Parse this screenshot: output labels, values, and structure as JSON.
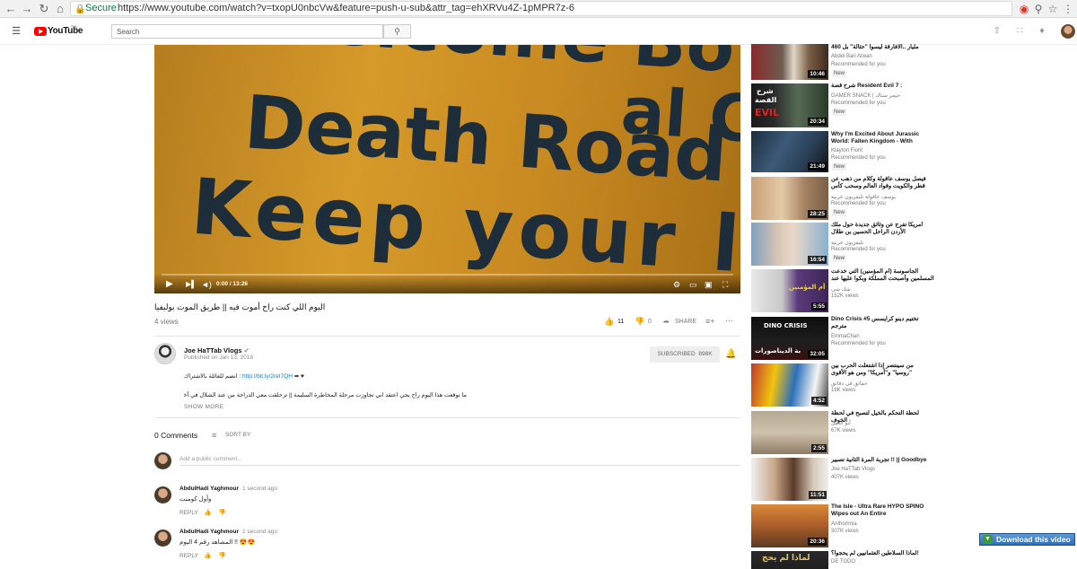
{
  "browser": {
    "secure_label": "Secure",
    "url": "https://www.youtube.com/watch?v=txopU0nbcVw&feature=push-u-sub&attr_tag=ehXRVu4Z-1pMPR7z-6"
  },
  "header": {
    "logo_text": "YouTube",
    "logo_region": "SA",
    "search_placeholder": "Search"
  },
  "player": {
    "sign_line1": "Welcome Bo",
    "sign_line2": "Death Road",
    "sign_line3": "al Cam",
    "sign_line4": "Keep your left Conse",
    "time": "0:00 / 13:26",
    "progress_fraction": 0
  },
  "video": {
    "title": "اليوم اللي كنت راح أموت فيه || طريق الموت بوليفيا",
    "views": "4 views",
    "likes": "11",
    "dislikes": "0",
    "share_label": "SHARE"
  },
  "channel": {
    "name": "Joe HaTTab Vlogs",
    "published": "Published on Jan 13, 2018",
    "subscribe_label": "SUBSCRIBED",
    "subscriber_count": "898K",
    "desc_line1_prefix": "انضم للعائلة بالاشتراك : ",
    "desc_link": "http://bit.ly/2reI7QH",
    "desc_line1_suffix": " ➡ ♥",
    "desc_line2": "ما توقعت هذا اليوم راح يجي اعتقد اني تجاوزت مرحلة المخاطرة السليمة || تزحلقت معي الدراجة من عند الشلال في أخطر طريق في العالم",
    "show_more": "SHOW MORE"
  },
  "comments": {
    "count_label": "0 Comments",
    "sort_label": "SORT BY",
    "placeholder": "Add a public comment...",
    "reply_label": "REPLY",
    "items": [
      {
        "author": "AbdulHadi Yaghmour",
        "time": "1 second ago",
        "text": "وأول كومنت"
      },
      {
        "author": "AbdulHadi Yaghmour",
        "time": "1 second ago",
        "text": "المشاهد رقم 4 اليوم !! 😍😍"
      }
    ]
  },
  "sidebar": {
    "items": [
      {
        "title": "460 مليار ..الافارقة ليسوا \"حثالة\" بل",
        "channel": "Abdel Bari Atwan",
        "meta": "Recommended for you",
        "badge": "New",
        "duration": "10:46"
      },
      {
        "title": "شرح قصة Resident Evil 7 :",
        "channel": "GAMER SNACK | جيمر سناك",
        "meta": "Recommended for you",
        "badge": "New",
        "duration": "20:34",
        "thumb_text1": "شرح",
        "thumb_text2": "القصة",
        "thumb_text3": "EVIL"
      },
      {
        "title": "Why I'm Excited About Jurassic World: Fallen Kingdom - With",
        "channel": "Klayton Fiorit",
        "meta": "Recommended for you",
        "badge": "New",
        "duration": "21:49"
      },
      {
        "title": "فيصل يوسف عاقولة وكلام من ذهب عن قطر والكويت وقواد العالم وسحب كأس الخليج",
        "channel": "يوسف عاقولة تليفزيون عربية",
        "meta": "Recommended for you",
        "badge": "New",
        "duration": "28:25"
      },
      {
        "title": "أمريكا تفرج عن وثائق جديدة حول ملك الأردن الراحل الحسين بن طلال",
        "channel": "تليفزيون عربية",
        "meta": "Recommended for you",
        "badge": "New",
        "duration": "16:54"
      },
      {
        "title": "الجاسوسة (أم المؤمنين) التي خدعت المسلمين وأصبحت المملكة وبكوا عليها عند وفاتها | قناة",
        "channel": "شك شي",
        "meta": "152K views",
        "badge": "",
        "duration": "5:55",
        "thumb_text1": "أم المؤمنين"
      },
      {
        "title": "Dino Crisis #5 تختيم دينو كرايسس مترجم",
        "channel": "EmmaChan",
        "meta": "Recommended for you",
        "badge": "",
        "duration": "32:05",
        "thumb_text1": "DINO CRISIS",
        "thumb_text2": "بة الديناصورات"
      },
      {
        "title": "من سينتصر إذا اشتعلت الحرب بين \"روسيا\" و\"أمريكا\" ومن هو الأقوى عسكريا؟",
        "channel": "حقائق في دقائق",
        "meta": "16K views",
        "badge": "",
        "duration": "4:52"
      },
      {
        "title": "لحظة التحكم بالخيل لتصبح في لحظة الخوف",
        "channel": "أبو الخيل",
        "meta": "67K views",
        "badge": "",
        "duration": "2:55"
      },
      {
        "title": "تجربة المرة الثانية تصبير !! || Goodbye",
        "channel": "Joe HaTTab Vlogs",
        "meta": "407K views",
        "badge": "",
        "duration": "11:51"
      },
      {
        "title": "The Isle - Ultra Rare HYPO SPINO Wipes out An Entire",
        "channel": "Anthomnia",
        "meta": "307K views",
        "badge": "",
        "duration": "20:36"
      },
      {
        "title": "لماذا السلاطين العثمانيين لم يحجوا؟!",
        "channel": "DE TODO",
        "meta": "",
        "badge": "",
        "duration": "",
        "thumb_text1": "لماذا لم يحج"
      }
    ]
  },
  "download_bar": {
    "label": "Download this video"
  }
}
